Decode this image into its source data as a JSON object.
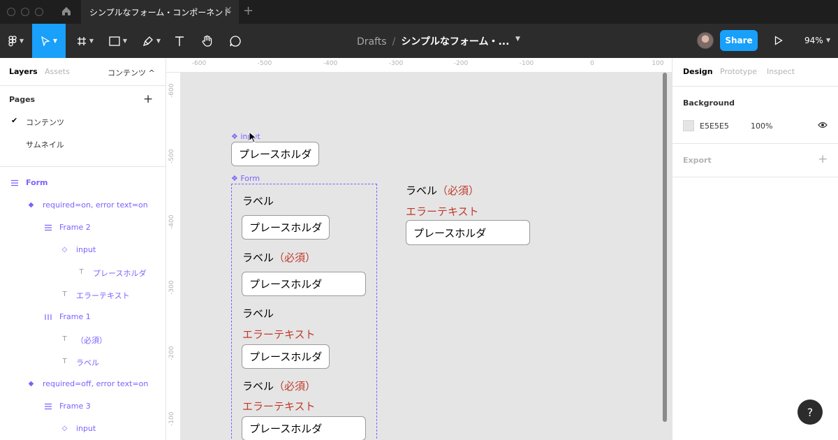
{
  "titlebar": {
    "tab_title": "シンプルなフォーム・コンポーネント",
    "tab_close": "✕",
    "tab_add": "+"
  },
  "toolbar": {
    "breadcrumb_parent": "Drafts",
    "breadcrumb_sep": "/",
    "breadcrumb_file": "シンプルなフォーム・...",
    "share_label": "Share",
    "zoom_level": "94%"
  },
  "left_panel": {
    "tabs": {
      "layers": "Layers",
      "assets": "Assets",
      "page_selector": "コンテンツ ^"
    },
    "pages_title": "Pages",
    "pages_add": "+",
    "pages": [
      {
        "label": "コンテンツ",
        "selected": true,
        "check": "✔"
      },
      {
        "label": "サムネイル",
        "selected": false
      }
    ],
    "layers": [
      {
        "label": "Form",
        "icon": "frame-grid-icon",
        "indent": 0,
        "bold": true
      },
      {
        "label": "required=on, error text=on",
        "icon": "variant-icon",
        "indent": 1
      },
      {
        "label": "Frame 2",
        "icon": "autolayout-vertical-icon",
        "indent": 2
      },
      {
        "label": "input",
        "icon": "instance-icon",
        "indent": 3
      },
      {
        "label": "プレースホルダ",
        "icon": "text-icon",
        "indent": 4
      },
      {
        "label": "エラーテキスト",
        "icon": "text-icon",
        "indent": 2
      },
      {
        "label": "Frame 1",
        "icon": "autolayout-horizontal-icon",
        "indent": 2
      },
      {
        "label": "（必須）",
        "icon": "text-icon",
        "indent": 3
      },
      {
        "label": "ラベル",
        "icon": "text-icon",
        "indent": 3
      },
      {
        "label": "required=off, error text=on",
        "icon": "variant-icon",
        "indent": 1
      },
      {
        "label": "Frame 3",
        "icon": "autolayout-vertical-icon",
        "indent": 2
      },
      {
        "label": "input",
        "icon": "instance-icon",
        "indent": 3
      }
    ]
  },
  "rulers": {
    "x_ticks": [
      "-600",
      "-500",
      "-400",
      "-300",
      "-200",
      "-100",
      "0",
      "100"
    ],
    "y_ticks": [
      "-600",
      "-500",
      "-400",
      "-300",
      "-200",
      "-100"
    ]
  },
  "canvas": {
    "input_component_label": "❖ input",
    "form_component_label": "❖ Form",
    "placeholder": "プレースホルダ",
    "label": "ラベル",
    "required": "（必須）",
    "error_text": "エラーテキスト"
  },
  "right_panel": {
    "tabs": {
      "design": "Design",
      "prototype": "Prototype",
      "inspect": "Inspect"
    },
    "background_title": "Background",
    "background_hex": "E5E5E5",
    "background_opacity": "100%",
    "export_title": "Export",
    "export_add": "+"
  },
  "help": {
    "label": "?"
  },
  "colors": {
    "accent": "#18a0fb",
    "component_purple": "#7b61ff",
    "error_red": "#c0392b",
    "canvas_bg": "#e5e5e5"
  }
}
